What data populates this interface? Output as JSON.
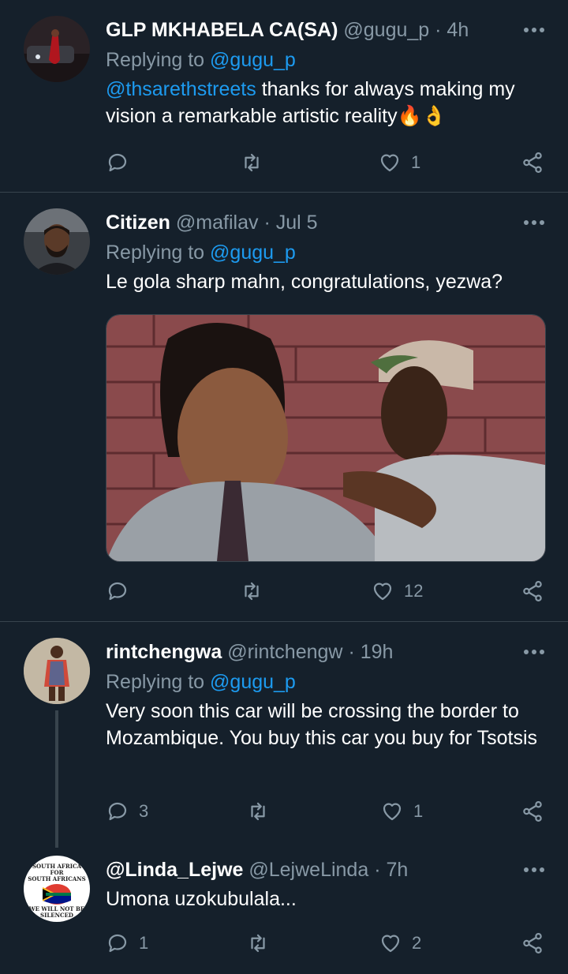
{
  "tweets": [
    {
      "display_name": "GLP MKHABELA CA(SA)",
      "handle": "@gugu_p",
      "time": "· 4h",
      "replying_label": "Replying to",
      "replying_to": "@gugu_p",
      "mention": "@thsarethstreets",
      "text": " thanks for always making my vision a remarkable artistic reality🔥👌",
      "replies": "",
      "retweets": "",
      "likes": "1"
    },
    {
      "display_name": "Citizen",
      "handle": "@mafilav",
      "time": "· Jul 5",
      "replying_label": "Replying to",
      "replying_to": "@gugu_p",
      "text": "Le gola sharp mahn, congratulations, yezwa?",
      "replies": "",
      "retweets": "",
      "likes": "12"
    },
    {
      "display_name": "rintchengwa",
      "handle": "@rintchengw",
      "time": "· 19h",
      "replying_label": "Replying to",
      "replying_to": "@gugu_p",
      "text": "Very soon this car  will be crossing the border to Mozambique. You buy this car you buy for Tsotsis",
      "replies": "3",
      "retweets": "",
      "likes": "1"
    },
    {
      "display_name": "@Linda_Lejwe",
      "handle": "@LejweLinda",
      "time": "· 7h",
      "text": "Umona uzokubulala...",
      "replies": "1",
      "retweets": "",
      "likes": "2",
      "avatar_badge": {
        "line1": "SOUTH AFRICA",
        "line2": "FOR",
        "line3": "SOUTH AFRICANS",
        "line4": "WE WILL NOT BE",
        "line5": "SILENCED"
      }
    }
  ],
  "colors": {
    "background": "#15202b",
    "text": "#ffffff",
    "muted": "#8899a6",
    "link": "#1d9bf0",
    "divider": "#38444d"
  },
  "icons": [
    "more-icon",
    "reply-icon",
    "retweet-icon",
    "like-icon",
    "share-icon"
  ]
}
